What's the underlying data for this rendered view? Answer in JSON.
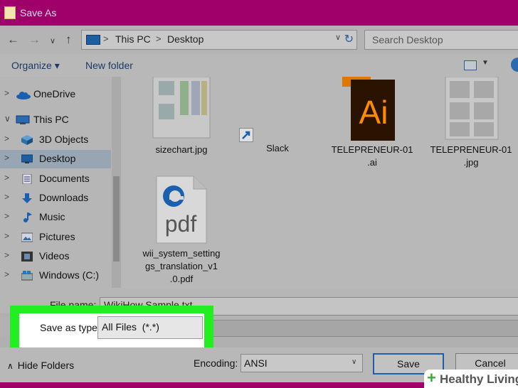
{
  "window": {
    "title": "Save As"
  },
  "nav": {
    "back": "←",
    "forward": "→",
    "dropdown": "∨",
    "up": "↑"
  },
  "address": {
    "crumbs": [
      "This PC",
      "Desktop"
    ],
    "separator": ">",
    "dropdown": "∨",
    "refresh": "↻"
  },
  "search": {
    "placeholder": "Search Desktop"
  },
  "toolbar": {
    "organize": "Organize ▾",
    "new_folder": "New folder",
    "view_dropdown": "▼"
  },
  "sidebar": {
    "items": [
      {
        "label": "OneDrive",
        "chevron": ">",
        "icon": "cloud-icon"
      },
      {
        "label": "This PC",
        "chevron": "∨",
        "icon": "computer-icon"
      },
      {
        "label": "3D Objects",
        "chevron": ">",
        "icon": "cube-icon"
      },
      {
        "label": "Desktop",
        "chevron": ">",
        "icon": "desktop-icon",
        "selected": true
      },
      {
        "label": "Documents",
        "chevron": ">",
        "icon": "document-icon"
      },
      {
        "label": "Downloads",
        "chevron": ">",
        "icon": "download-arrow-icon"
      },
      {
        "label": "Music",
        "chevron": ">",
        "icon": "music-note-icon"
      },
      {
        "label": "Pictures",
        "chevron": ">",
        "icon": "picture-icon"
      },
      {
        "label": "Videos",
        "chevron": ">",
        "icon": "film-icon"
      },
      {
        "label": "Windows (C:)",
        "chevron": ">",
        "icon": "drive-icon"
      }
    ]
  },
  "files": [
    {
      "name_lines": [
        "sizechart.jpg"
      ],
      "icon": "image-thumbnail-icon"
    },
    {
      "name_lines": [
        "Slack"
      ],
      "icon": "shortcut-icon"
    },
    {
      "name_lines": [
        "TELEPRENEUR-01",
        ".ai"
      ],
      "icon": "illustrator-file-icon",
      "badge": "Ai"
    },
    {
      "name_lines": [
        "TELEPRENEUR-01",
        ".jpg"
      ],
      "icon": "image-thumbnail-icon"
    },
    {
      "name_lines": [
        "wii_system_setting",
        "gs_translation_v1",
        ".0.pdf"
      ],
      "icon": "edge-pdf-icon",
      "badge": "pdf"
    }
  ],
  "filename": {
    "label": "File name:",
    "value": "WikiHow Sample.txt"
  },
  "save_as_type": {
    "label": "Save as type:",
    "value": "All Files  (*.*)"
  },
  "hide_folders": {
    "label": "Hide Folders",
    "chevron": "∧"
  },
  "encoding": {
    "label": "Encoding:",
    "value": "ANSI",
    "dropdown": "∨"
  },
  "buttons": {
    "save": "Save",
    "cancel": "Cancel"
  },
  "watermark": {
    "text": "Healthy Living",
    "plus": "+"
  },
  "colors": {
    "titlebar": "#a0006a",
    "highlight": "#22ee22",
    "selected": "#98a6b4"
  }
}
